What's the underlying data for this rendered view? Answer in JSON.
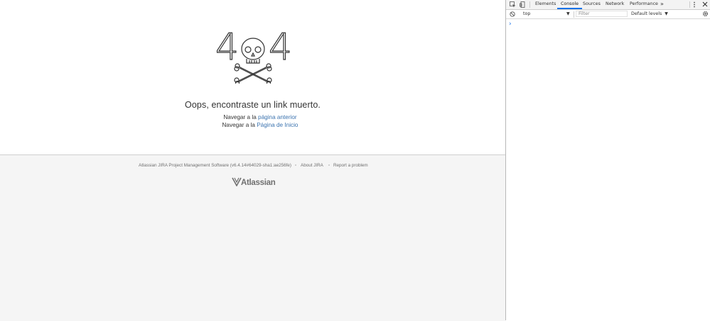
{
  "page": {
    "art_digits": [
      "4",
      "4"
    ],
    "headline": "Oops, encontraste un link muerto.",
    "nav": [
      {
        "prefix": "Navegar a la ",
        "link": "página anterior"
      },
      {
        "prefix": "Navegar a la ",
        "link": "Página de Inicio"
      }
    ],
    "footer": {
      "version": "Atlassian JIRA Project Management Software (v6.4.14#64029-sha1:ae256fe)",
      "about": "About JIRA",
      "report": "Report a problem",
      "logo_text": "Atlassian"
    },
    "colors": {
      "link": "#3b73af",
      "footer_bg": "#f5f5f5",
      "accent": "#1a73e8"
    }
  },
  "devtools": {
    "tabs": [
      "Elements",
      "Console",
      "Sources",
      "Network",
      "Performance"
    ],
    "active_tab": "Console",
    "more_tabs": "»",
    "context": "top",
    "filter_placeholder": "Filter",
    "levels": "Default levels",
    "prompt": "›",
    "icons": [
      "inspect-icon",
      "device-toolbar-icon",
      "more-tabs-icon",
      "kebab-menu-icon",
      "close-icon",
      "clear-console-icon",
      "settings-gear-icon",
      "console-prompt-icon"
    ]
  }
}
